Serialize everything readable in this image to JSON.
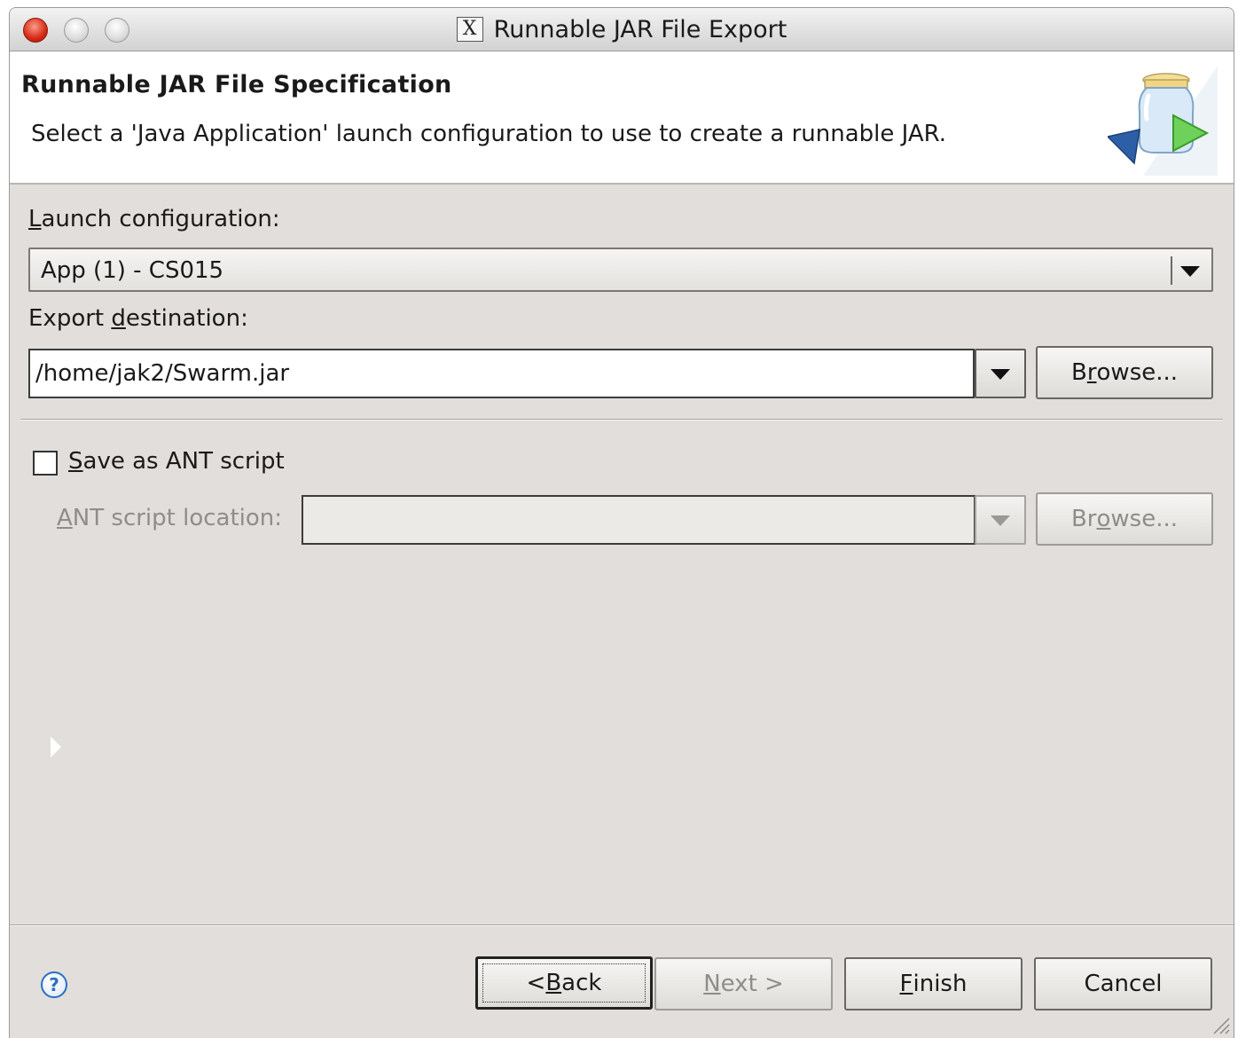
{
  "window": {
    "title": "Runnable JAR File Export"
  },
  "header": {
    "title": "Runnable JAR File Specification",
    "description": "Select a 'Java Application' launch configuration to use to create a runnable JAR."
  },
  "launch": {
    "label_prefix": "",
    "label_mnemonic": "L",
    "label_rest": "aunch configuration:",
    "selected": "App (1) - CS015"
  },
  "destination": {
    "label_prefix": "Export ",
    "label_mnemonic": "d",
    "label_rest": "estination:",
    "value": "/home/jak2/Swarm.jar",
    "browse_prefix": "B",
    "browse_mnemonic": "r",
    "browse_rest": "owse..."
  },
  "ant": {
    "checkbox_mnemonic": "S",
    "checkbox_rest": "ave as ANT script",
    "checked": false,
    "location_mnemonic": "A",
    "location_rest": "NT script location:",
    "location_value": "",
    "browse_prefix": "Br",
    "browse_mnemonic": "o",
    "browse_rest": "wse..."
  },
  "footer": {
    "back_prefix": "< ",
    "back_mnemonic": "B",
    "back_rest": "ack",
    "next_mnemonic": "N",
    "next_rest": "ext >",
    "finish_mnemonic": "F",
    "finish_rest": "inish",
    "cancel_label": "Cancel",
    "help_glyph": "?"
  }
}
